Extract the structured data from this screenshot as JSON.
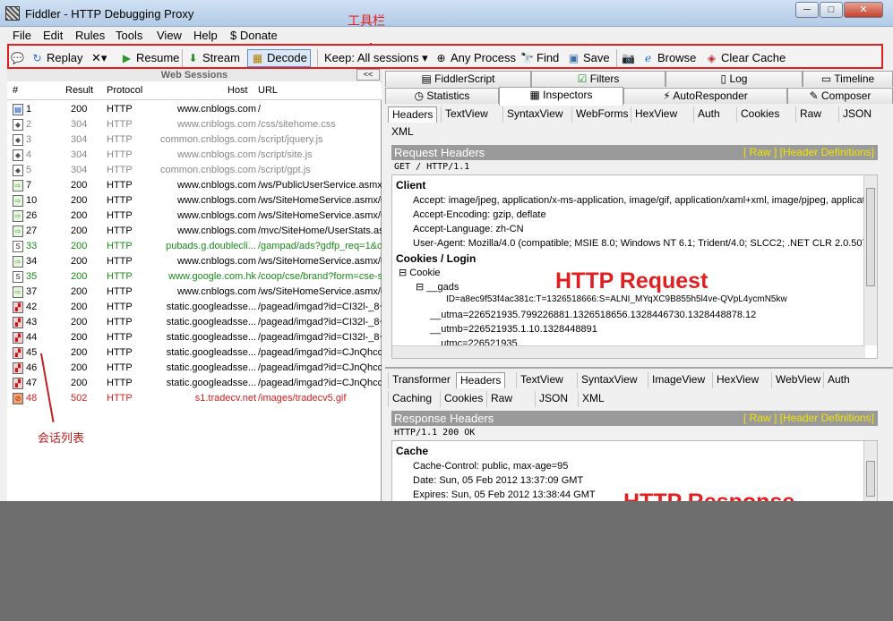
{
  "window": {
    "title": "Fiddler - HTTP Debugging Proxy",
    "min": "─",
    "max": "□",
    "close": "✕"
  },
  "menu": [
    "File",
    "Edit",
    "Rules",
    "Tools",
    "View",
    "Help",
    "$ Donate"
  ],
  "toolbar": {
    "replay": "Replay",
    "remove": "✕▾",
    "resume": "Resume",
    "stream": "Stream",
    "decode": "Decode",
    "keep": "Keep: All sessions ▾",
    "any_process": "Any Process",
    "find": "Find",
    "save": "Save",
    "browse": "Browse",
    "clear_cache": "Clear Cache"
  },
  "annotations": {
    "toolbar": "工具栏",
    "sessions": "会话列表",
    "http_request": "HTTP Request",
    "http_response": "HTTP Response"
  },
  "sessions_panel": {
    "title": "Web Sessions",
    "collapse": "<<",
    "columns": [
      "#",
      "Result",
      "Protocol",
      "Host",
      "URL"
    ],
    "rows": [
      {
        "num": "1",
        "result": "200",
        "protocol": "HTTP",
        "host": "www.cnblogs.com",
        "url": "/",
        "style": "normal"
      },
      {
        "num": "2",
        "result": "304",
        "protocol": "HTTP",
        "host": "www.cnblogs.com",
        "url": "/css/sitehome.css",
        "style": "gray"
      },
      {
        "num": "3",
        "result": "304",
        "protocol": "HTTP",
        "host": "common.cnblogs.com",
        "url": "/script/jquery.js",
        "style": "gray"
      },
      {
        "num": "4",
        "result": "304",
        "protocol": "HTTP",
        "host": "www.cnblogs.com",
        "url": "/script/site.js",
        "style": "gray"
      },
      {
        "num": "5",
        "result": "304",
        "protocol": "HTTP",
        "host": "common.cnblogs.com",
        "url": "/script/gpt.js",
        "style": "gray"
      },
      {
        "num": "7",
        "result": "200",
        "protocol": "HTTP",
        "host": "www.cnblogs.com",
        "url": "/ws/PublicUserService.asmx/",
        "style": "normal"
      },
      {
        "num": "10",
        "result": "200",
        "protocol": "HTTP",
        "host": "www.cnblogs.com",
        "url": "/ws/SiteHomeService.asmx/G",
        "style": "normal"
      },
      {
        "num": "26",
        "result": "200",
        "protocol": "HTTP",
        "host": "www.cnblogs.com",
        "url": "/ws/SiteHomeService.asmx/G",
        "style": "normal"
      },
      {
        "num": "27",
        "result": "200",
        "protocol": "HTTP",
        "host": "www.cnblogs.com",
        "url": "/mvc/SiteHome/UserStats.as",
        "style": "normal"
      },
      {
        "num": "33",
        "result": "200",
        "protocol": "HTTP",
        "host": "pubads.g.doublecli...",
        "url": "/gampad/ads?gdfp_req=1&c",
        "style": "green"
      },
      {
        "num": "34",
        "result": "200",
        "protocol": "HTTP",
        "host": "www.cnblogs.com",
        "url": "/ws/SiteHomeService.asmx/G",
        "style": "normal"
      },
      {
        "num": "35",
        "result": "200",
        "protocol": "HTTP",
        "host": "www.google.com.hk",
        "url": "/coop/cse/brand?form=cse-s",
        "style": "green"
      },
      {
        "num": "37",
        "result": "200",
        "protocol": "HTTP",
        "host": "www.cnblogs.com",
        "url": "/ws/SiteHomeService.asmx/G",
        "style": "normal"
      },
      {
        "num": "42",
        "result": "200",
        "protocol": "HTTP",
        "host": "static.googleadsse...",
        "url": "/pagead/imgad?id=CI32l-_8~",
        "style": "normal"
      },
      {
        "num": "43",
        "result": "200",
        "protocol": "HTTP",
        "host": "static.googleadsse...",
        "url": "/pagead/imgad?id=CI32l-_8~",
        "style": "normal"
      },
      {
        "num": "44",
        "result": "200",
        "protocol": "HTTP",
        "host": "static.googleadsse...",
        "url": "/pagead/imgad?id=CI32l-_8~",
        "style": "normal"
      },
      {
        "num": "45",
        "result": "200",
        "protocol": "HTTP",
        "host": "static.googleadsse...",
        "url": "/pagead/imgad?id=CJnQhcq",
        "style": "normal"
      },
      {
        "num": "46",
        "result": "200",
        "protocol": "HTTP",
        "host": "static.googleadsse...",
        "url": "/pagead/imgad?id=CJnQhcq",
        "style": "normal"
      },
      {
        "num": "47",
        "result": "200",
        "protocol": "HTTP",
        "host": "static.googleadsse...",
        "url": "/pagead/imgad?id=CJnQhcq",
        "style": "normal"
      },
      {
        "num": "48",
        "result": "502",
        "protocol": "HTTP",
        "host": "s1.tradecv.net",
        "url": "/images/tradecv5.gif",
        "style": "red"
      }
    ]
  },
  "right_tabs": {
    "row1": [
      "FiddlerScript",
      "Filters",
      "Log",
      "Timeline"
    ],
    "row2": [
      "Statistics",
      "Inspectors",
      "AutoResponder",
      "Composer"
    ],
    "request_subtabs": [
      "Headers",
      "TextView",
      "SyntaxView",
      "WebForms",
      "HexView",
      "Auth",
      "Cookies",
      "Raw",
      "JSON",
      "XML"
    ],
    "response_subtabs_row1": [
      "Transformer",
      "Headers",
      "TextView",
      "SyntaxView",
      "ImageView",
      "HexView",
      "WebView",
      "Auth"
    ],
    "response_subtabs_row2": [
      "Caching",
      "Cookies",
      "Raw",
      "JSON",
      "XML"
    ]
  },
  "request": {
    "header_title": "Request Headers",
    "header_links": "[ Raw ]   [Header Definitions]",
    "request_line": "GET / HTTP/1.1",
    "client_title": "Client",
    "client": [
      "Accept: image/jpeg, application/x-ms-application, image/gif, application/xaml+xml, image/pjpeg, applicati",
      "Accept-Encoding: gzip, deflate",
      "Accept-Language: zh-CN",
      "User-Agent: Mozilla/4.0 (compatible; MSIE 8.0; Windows NT 6.1; Trident/4.0; SLCC2; .NET CLR 2.0.5072"
    ],
    "cookies_title": "Cookies / Login",
    "cookie_node": "Cookie",
    "gads_node": "__gads",
    "gads_value": "ID=a8ec9f53f4ac381c:T=1326518666:S=ALNI_MYqXC9B855h5l4ve-QVpL4ycmN5kw",
    "utma": "__utma=226521935.799226881.1326518656.1328446730.1328448878.12",
    "utmb": "__utmb=226521935.1.10.1328448891",
    "utmc": "__utmc=226521935"
  },
  "response": {
    "header_title": "Response Headers",
    "header_links": "[ Raw ]   [Header Definitions]",
    "status_line": "HTTP/1.1 200 OK",
    "cache_title": "Cache",
    "cache": [
      "Cache-Control: public, max-age=95",
      "Date: Sun, 05 Feb 2012 13:37:09 GMT",
      "Expires: Sun, 05 Feb 2012 13:38:44 GMT"
    ]
  },
  "colors": {
    "annotation": "#e02020",
    "header_bar": "#9a9a9a",
    "header_links": "#f2e200"
  }
}
